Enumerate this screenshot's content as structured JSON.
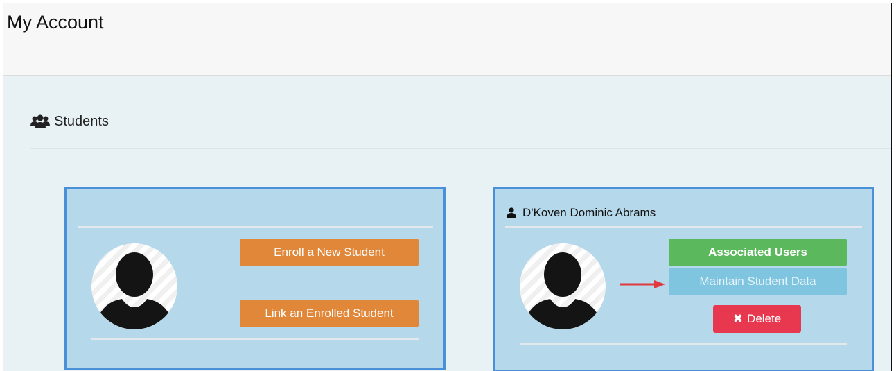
{
  "page": {
    "title": "My Account"
  },
  "section": {
    "title": "Students",
    "icon": "users-icon"
  },
  "enroll_card": {
    "avatar_icon": "avatar-placeholder-icon",
    "enroll_button": "Enroll a New Student",
    "link_button": "Link an Enrolled Student"
  },
  "student_card": {
    "user_icon": "user-icon",
    "name": "D'Koven Dominic Abrams",
    "avatar_icon": "avatar-placeholder-icon",
    "associated_users_button": "Associated Users",
    "maintain_data_button": "Maintain Student Data",
    "delete_button": "Delete",
    "delete_icon": "close-icon",
    "delete_glyph": "✖",
    "annotation_arrow_icon": "red-arrow-icon"
  },
  "colors": {
    "orange_button": "#e0873a",
    "green_button": "#5cb85c",
    "light_blue_button": "#7fc5e0",
    "red_button": "#e8384f",
    "card_border": "#4a90d9",
    "card_background": "#b6d8eb"
  }
}
